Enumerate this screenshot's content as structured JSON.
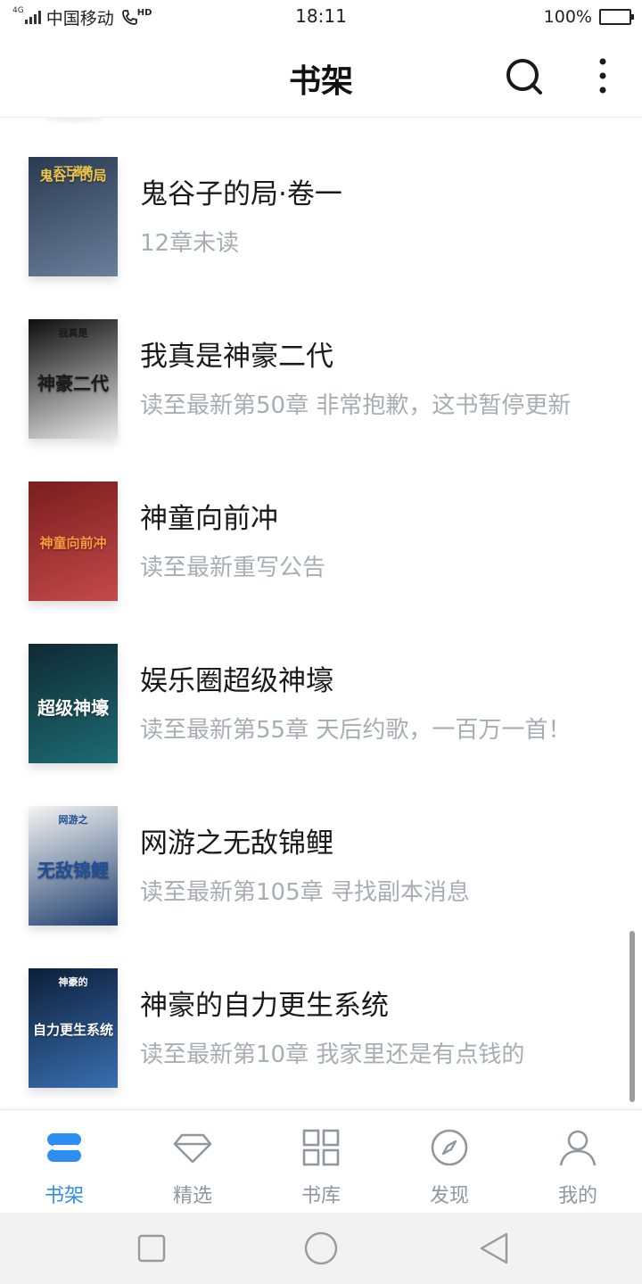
{
  "status_bar": {
    "network_tag": "4G",
    "carrier": "中国移动",
    "hd_label": "HD",
    "time": "18:11",
    "battery_percent": "100%",
    "battery_level": 1.0
  },
  "header": {
    "title": "书架",
    "search_icon": "search-icon",
    "more_icon": "more-vertical-icon"
  },
  "books": [
    {
      "title": "鬼谷子的局·卷一",
      "progress": "12章未读",
      "cover": {
        "text": "鬼谷子的局",
        "tag": "天下谋略",
        "colors": [
          "#2a3a52",
          "#6b7f9a"
        ],
        "text_color": "#f2c94c"
      }
    },
    {
      "title": "我真是神豪二代",
      "progress": "读至最新第50章 非常抱歉，这书暂停更新",
      "cover": {
        "text": "神豪二代",
        "tag": "我真是",
        "colors": [
          "#0d0d0d",
          "#e9e9e9"
        ],
        "text_color": "#1a1a1a"
      }
    },
    {
      "title": "神童向前冲",
      "progress": "读至最新重写公告",
      "cover": {
        "text": "神童向前冲",
        "tag": "",
        "colors": [
          "#7a1d1d",
          "#c44a4a"
        ],
        "text_color": "#ff9a3c"
      }
    },
    {
      "title": "娱乐圈超级神壕",
      "progress": "读至最新第55章 天后约歌，一百万一首！",
      "cover": {
        "text": "超级神壕",
        "tag": "",
        "colors": [
          "#0f2a33",
          "#1d6b73"
        ],
        "text_color": "#ffffff"
      }
    },
    {
      "title": "网游之无敌锦鲤",
      "progress": "读至最新第105章 寻找副本消息",
      "cover": {
        "text": "无敌锦鲤",
        "tag": "网游之",
        "colors": [
          "#f4f4f4",
          "#1f3f6e"
        ],
        "text_color": "#1f4f9a"
      }
    },
    {
      "title": "神豪的自力更生系统",
      "progress": "读至最新第10章 我家里还是有点钱的",
      "cover": {
        "text": "自力更生系统",
        "tag": "神豪的",
        "colors": [
          "#0c1f3a",
          "#3a6fb0"
        ],
        "text_color": "#ffffff"
      }
    }
  ],
  "bottom_nav": [
    {
      "label": "书架",
      "icon": "bookshelf-icon",
      "active": true
    },
    {
      "label": "精选",
      "icon": "diamond-icon",
      "active": false
    },
    {
      "label": "书库",
      "icon": "grid-icon",
      "active": false
    },
    {
      "label": "发现",
      "icon": "compass-icon",
      "active": false
    },
    {
      "label": "我的",
      "icon": "person-icon",
      "active": false
    }
  ],
  "system_nav": [
    "recent-apps-icon",
    "home-icon",
    "back-icon"
  ],
  "colors": {
    "accent": "#2f8ef2",
    "inactive": "#8f979f",
    "secondary_text": "#a8adb3"
  }
}
